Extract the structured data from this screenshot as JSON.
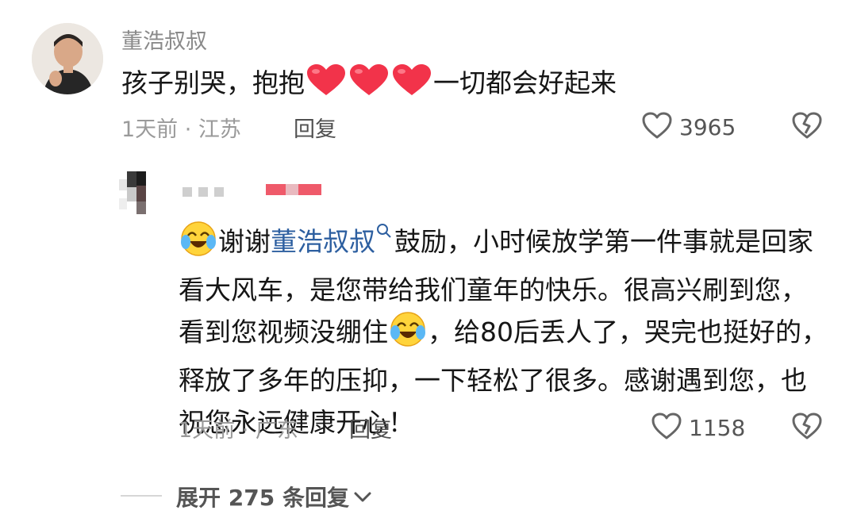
{
  "top_comment": {
    "username": "董浩叔叔",
    "text_before": "孩子别哭，抱抱",
    "hearts": [
      "heart-emoji",
      "heart-emoji",
      "heart-emoji"
    ],
    "text_after": "一切都会好起来",
    "meta": "1天前 · 江苏",
    "reply_label": "回复",
    "like_count": "3965"
  },
  "reply_comment": {
    "username": "",
    "line_parts": {
      "p1": "谢谢",
      "mention": "董浩叔叔",
      "p2": "鼓励，小时候放学第一件事就是回家看大风车，是您带给我们童年的快乐。很高兴刷到您，看到您视频没绷住",
      "p3": "，给80后丢人了，哭完也挺好的，释放了多年的压抑，一下轻松了很多。感谢遇到您，也祝您永远健康开心！"
    },
    "meta": "1天前 · 广东",
    "reply_label": "回复",
    "like_count": "1158"
  },
  "expand": {
    "label": "展开 275 条回复"
  },
  "colors": {
    "mention": "#2d5fa0",
    "heart": "#f2334a",
    "meta": "#9a9a9a"
  }
}
